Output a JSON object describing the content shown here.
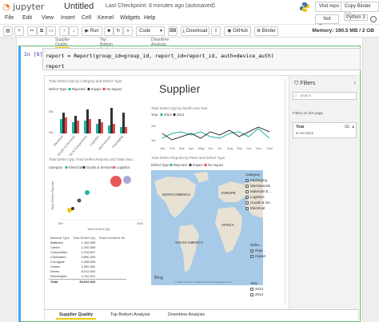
{
  "header": {
    "logo_text": "jupyter",
    "notebook_title": "Untitled",
    "checkpoint": "Last Checkpoint: 6 minutes ago  (autosaved)",
    "visit_repo": "Visit repo",
    "copy_binder": "Copy Binder link"
  },
  "menu": {
    "items": [
      "File",
      "Edit",
      "View",
      "Insert",
      "Cell",
      "Kernel",
      "Widgets",
      "Help"
    ],
    "trust": "Not Trusted",
    "kernel": "Python 3"
  },
  "toolbar": {
    "run_label": "Run",
    "cell_type": "Code",
    "download_label": "Download",
    "github_label": "GitHub",
    "binder_label": "Binder",
    "memory": "Memory: 190.5 MB / 2 GB"
  },
  "prev_tabs": [
    "Supplier Quality",
    "Top Bottom Analysis",
    "Downtime Analysis"
  ],
  "cell": {
    "prompt": "In [8]:",
    "line1": "report = Report(group_id=group_id, report_id=report_id, auth=device_auth)",
    "line2": "report"
  },
  "report": {
    "title": "Supplier",
    "visual1_title": "Total Defect Qty by Category and Defect Type",
    "visual1_legend": [
      "Defect Type",
      "Rejected",
      "Impact",
      "No Impact"
    ],
    "visual1_yticks": [
      "5M",
      "0M"
    ],
    "visual1_categories": [
      "Electrical",
      "Goods & Services",
      "Materials & Components",
      "Logistics",
      "Mechanicals",
      "Packaging"
    ],
    "visual2_title": "Total Defect Qty by Month and Year",
    "visual2_legend": [
      "Year",
      "2013",
      "2014"
    ],
    "visual2_yticks": [
      "2M",
      "1M"
    ],
    "visual2_months": [
      "Jan",
      "Feb",
      "Mar",
      "Apr",
      "May",
      "Jun",
      "Jul",
      "Aug",
      "Sep",
      "Oct",
      "Nov",
      "Dec"
    ],
    "visual3_title": "Total Defect Qty, Total Defect Reports and Total Dow...",
    "visual3_legend": [
      "Category",
      "Electrical",
      "Goods & Services",
      "Logistics"
    ],
    "visual3_ylabel": "Total Defect Reports",
    "visual3_xlabel": "Total Defect Qty",
    "visual3_xticks": [
      "0M",
      "20M"
    ],
    "visual4_title": "Total Defect Reports by Plant and Defect Type",
    "visual4_legend": [
      "Defect Type",
      "Rejected",
      "Impact",
      "No Impact"
    ],
    "map_labels": [
      "NORTH AMERICA",
      "EUROPE",
      "AFRICA",
      "SOUTH AMERICA"
    ],
    "map_bing": "Bing",
    "map_copyright": "© 2021 TomTom  © 2021 Microsoft Corporation  Terms",
    "table": {
      "headers": [
        "Material Type",
        "Total Defect Qty",
        "Total Downtime Mi"
      ],
      "rows": [
        [
          "Batteries",
          "1,162,939",
          ""
        ],
        [
          "Carton",
          "1,020,939",
          ""
        ],
        [
          "Composites",
          "1,218,827",
          ""
        ],
        [
          "Controllers",
          "4,890,329",
          ""
        ],
        [
          "Corrugate",
          "1,298,326",
          ""
        ],
        [
          "Crates",
          "1,000,081",
          ""
        ],
        [
          "Drives",
          "8,012,004",
          ""
        ],
        [
          "Electrolytes",
          "1,212,921",
          ""
        ]
      ],
      "total": [
        "Total",
        "56,816,933",
        ""
      ]
    },
    "slicer_category": {
      "title": "Category",
      "items": [
        "Packaging",
        "Mechanicals",
        "Materials & ...",
        "Logistics",
        "Goods & Se...",
        "Electrical"
      ]
    },
    "slicer_defect": {
      "title": "Defec...",
      "items": [
        "Reje...",
        "Impact"
      ]
    },
    "slicer_year": {
      "title": "Year",
      "items": [
        "2013",
        "2014"
      ]
    },
    "filters": {
      "title": "Filters",
      "search_placeholder": "Search",
      "section": "Filters on this page",
      "card_title": "Year",
      "card_value": "is not 2012"
    },
    "bottom_tabs": [
      "Supplier Quality",
      "Top Bottom Analysis",
      "Downtime Analysis"
    ]
  },
  "colors": {
    "rejected": "#1fb4a0",
    "impact": "#333333",
    "no_impact": "#e8444b",
    "logistics": "#e85a5a",
    "electrical": "#1fb4a0",
    "goods": "#333333",
    "jupyter_orange": "#f37726",
    "ocean": "#a6cae8",
    "land": "#e8e2d4"
  }
}
